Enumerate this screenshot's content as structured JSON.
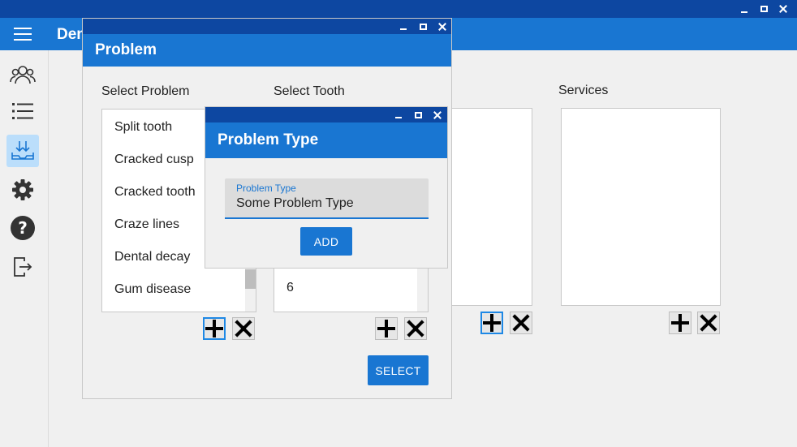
{
  "app": {
    "title": "Dental Clinic",
    "colors": {
      "title_bar": "#0d47a1",
      "app_bar": "#1976d2",
      "active_nav": "#bbdefb"
    }
  },
  "sidebar": {
    "items": [
      {
        "icon": "users-icon",
        "active": false
      },
      {
        "icon": "list-icon",
        "active": false
      },
      {
        "icon": "download-tray-icon",
        "active": true
      },
      {
        "icon": "gear-icon",
        "active": false
      },
      {
        "icon": "help-icon",
        "active": false
      },
      {
        "icon": "logout-icon",
        "active": false
      }
    ]
  },
  "background": {
    "services_label": "Services"
  },
  "problem_dialog": {
    "title": "Problem",
    "select_problem_label": "Select Problem",
    "select_tooth_label": "Select Tooth",
    "problems": [
      "Split tooth",
      "Cracked cusp",
      "Cracked tooth",
      "Craze lines",
      "Dental decay",
      "Gum disease"
    ],
    "tooth_visible_item": "6",
    "select_button": "SELECT"
  },
  "problem_type_dialog": {
    "title": "Problem Type",
    "field_label": "Problem Type",
    "field_value": "Some Problem Type",
    "add_button": "ADD"
  }
}
